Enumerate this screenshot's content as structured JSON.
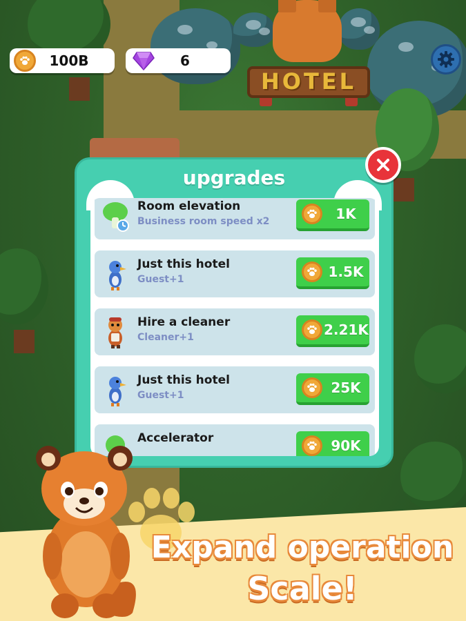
{
  "hud": {
    "coins": "100B",
    "gems": "6"
  },
  "world": {
    "sign_text": "HOTEL"
  },
  "panel": {
    "title": "upgrades",
    "rows": [
      {
        "title": "Room elevation",
        "subtitle": "Business room  speed x2",
        "price": "1K",
        "icon": "mushroom-clock-icon"
      },
      {
        "title": "Just this hotel",
        "subtitle": "Guest+1",
        "price": "1.5K",
        "icon": "bird-guest-icon"
      },
      {
        "title": "Hire a cleaner",
        "subtitle": "Cleaner+1",
        "price": "2.21K",
        "icon": "cleaner-character-icon"
      },
      {
        "title": "Just this hotel",
        "subtitle": "Guest+1",
        "price": "25K",
        "icon": "bird-guest-icon"
      },
      {
        "title": "Accelerator",
        "subtitle": "",
        "price": "90K",
        "icon": "accelerator-icon"
      }
    ]
  },
  "promo": {
    "line1": "Expand operation",
    "line2": "Scale!"
  },
  "colors": {
    "panel": "#46cfb0",
    "buy_button": "#3fcf4a",
    "close_button": "#e8333a",
    "row_bg": "#cde3ea",
    "subtitle": "#7d8ec4",
    "banner": "#fbe7a8"
  }
}
